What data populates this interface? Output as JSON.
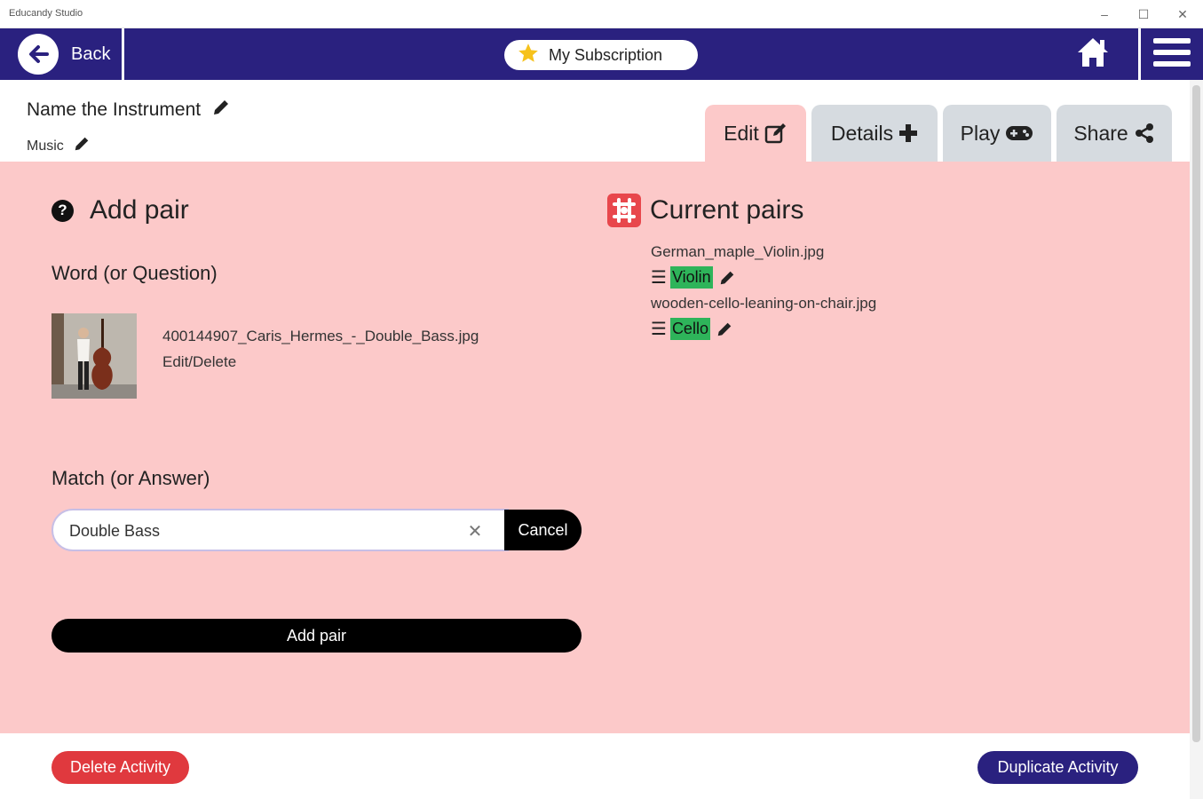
{
  "window": {
    "title": "Educandy Studio",
    "controls": {
      "minimize": "–",
      "maximize": "☐",
      "close": "✕"
    }
  },
  "nav": {
    "back_label": "Back",
    "subscription_label": "My Subscription",
    "bar_color": "#2a217f"
  },
  "activity": {
    "title": "Name the Instrument",
    "category": "Music"
  },
  "tabs": [
    {
      "label": "Edit",
      "icon": "edit-icon",
      "active": true
    },
    {
      "label": "Details",
      "icon": "plus-icon",
      "active": false
    },
    {
      "label": "Play",
      "icon": "gamepad-icon",
      "active": false
    },
    {
      "label": "Share",
      "icon": "share-icon",
      "active": false
    }
  ],
  "add_pair": {
    "heading": "Add pair",
    "word_label": "Word (or Question)",
    "word_image_file": "400144907_Caris_Hermes_-_Double_Bass.jpg",
    "edit_delete_label": "Edit/Delete",
    "match_label": "Match (or Answer)",
    "match_value": "Double Bass",
    "clear_symbol": "✕",
    "cancel_label": "Cancel",
    "submit_label": "Add pair"
  },
  "current_pairs": {
    "heading": "Current pairs",
    "items": [
      {
        "file": "German_maple_Violin.jpg",
        "match": "Violin"
      },
      {
        "file": "wooden-cello-leaning-on-chair.jpg",
        "match": "Cello"
      }
    ]
  },
  "footer": {
    "delete_label": "Delete Activity",
    "duplicate_label": "Duplicate Activity"
  },
  "colors": {
    "panel": "#fcc9c9",
    "accent": "#2a217f",
    "delete": "#e0393e",
    "match_tag": "#2eb45a"
  }
}
